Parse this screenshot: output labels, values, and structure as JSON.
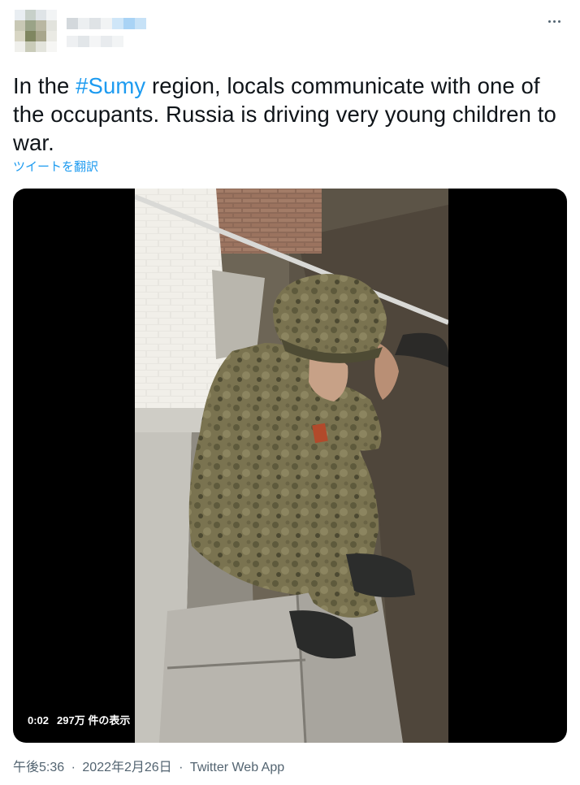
{
  "tweet": {
    "more_icon": "ellipsis-icon",
    "text_before": "In the ",
    "hashtag": "#Sumy",
    "text_after": " region, locals communicate with one of the occupants. Russia is driving very young children to war.",
    "translate_label": "ツイートを翻訳"
  },
  "media": {
    "type": "video",
    "elapsed": "0:02",
    "views": "297万 件の表示"
  },
  "meta": {
    "time": "午後5:36",
    "date": "2022年2月26日",
    "separator": "·",
    "client": "Twitter Web App"
  },
  "colors": {
    "accent": "#1d9bf0",
    "text": "#0f1419",
    "secondary": "#536471"
  }
}
